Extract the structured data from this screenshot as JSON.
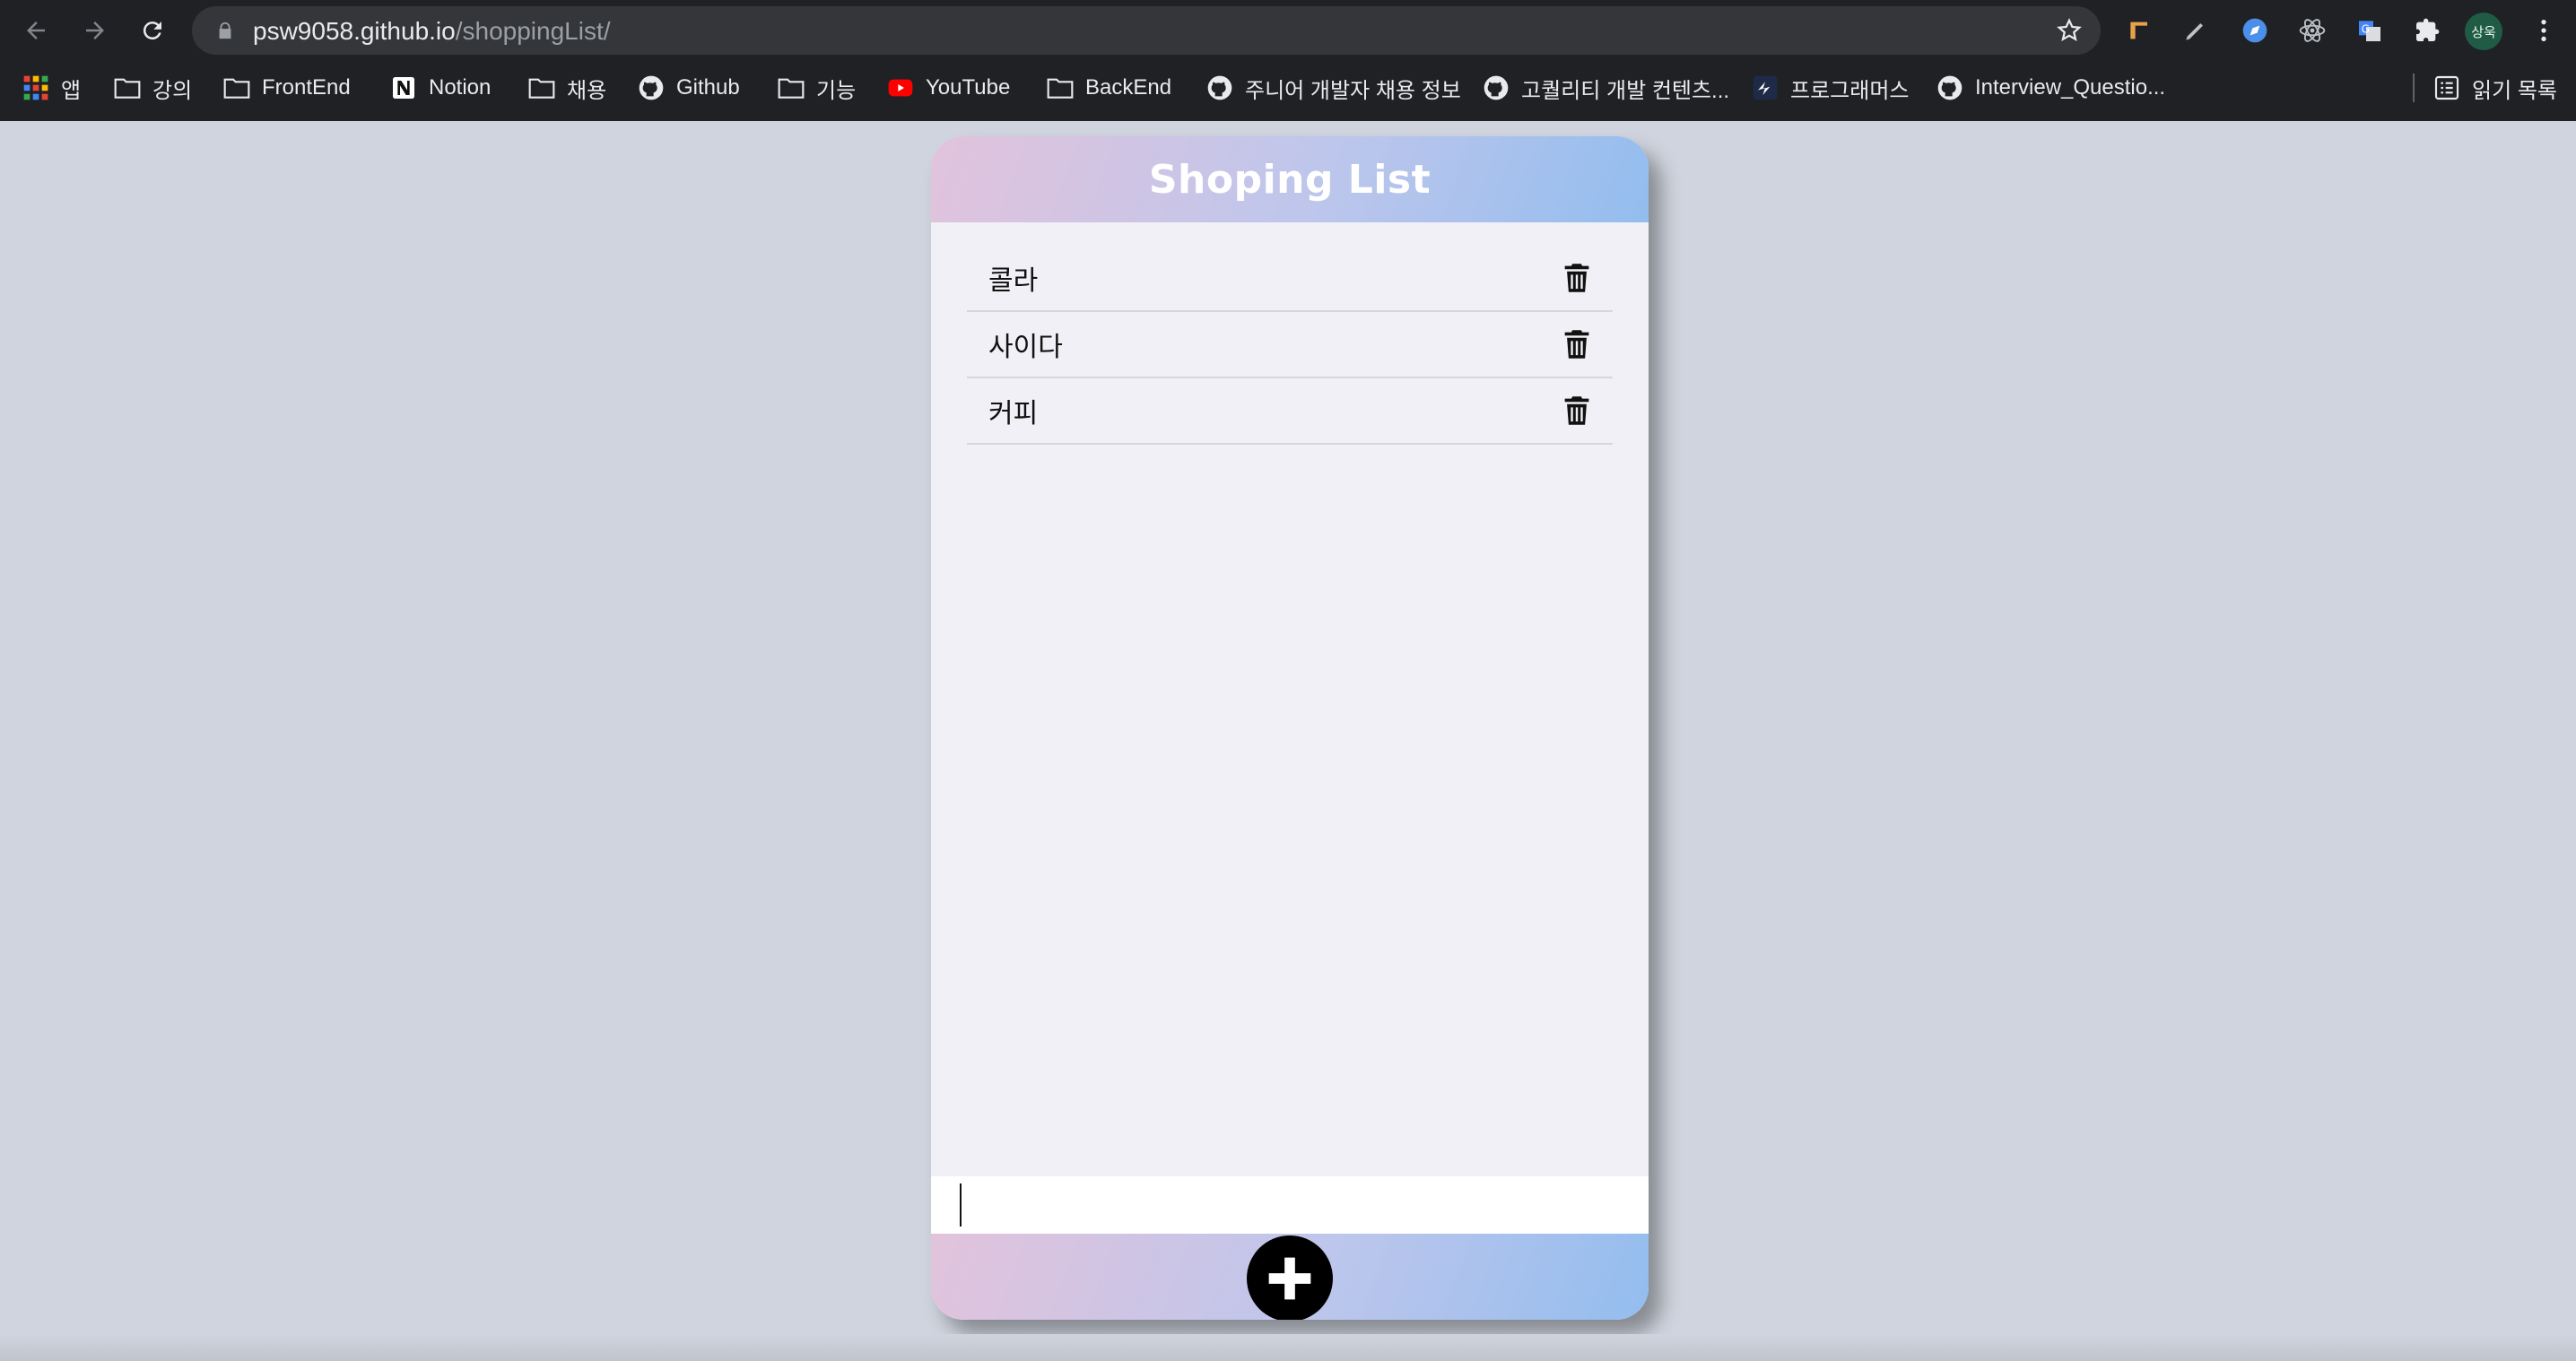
{
  "browser": {
    "url_host": "psw9058.github.io",
    "url_path": "/shoppingList/",
    "profile_initials": "상욱",
    "bookmarks": [
      {
        "label": "앱",
        "icon": "apps-grid-icon"
      },
      {
        "label": "강의",
        "icon": "folder-icon"
      },
      {
        "label": "FrontEnd",
        "icon": "folder-icon"
      },
      {
        "label": "Notion",
        "icon": "notion-icon"
      },
      {
        "label": "채용",
        "icon": "folder-icon"
      },
      {
        "label": "Github",
        "icon": "github-icon"
      },
      {
        "label": "기능",
        "icon": "folder-icon"
      },
      {
        "label": "YouTube",
        "icon": "youtube-icon"
      },
      {
        "label": "BackEnd",
        "icon": "folder-icon"
      },
      {
        "label": "주니어 개발자 채용 정보",
        "icon": "github-icon"
      },
      {
        "label": "고퀄리티 개발 컨텐츠...",
        "icon": "github-icon"
      },
      {
        "label": "프로그래머스",
        "icon": "programmers-icon"
      },
      {
        "label": "Interview_Questio...",
        "icon": "github-icon"
      }
    ],
    "reading_list_label": "읽기 목록"
  },
  "app": {
    "title": "Shoping List",
    "items": [
      {
        "name": "콜라"
      },
      {
        "name": "사이다"
      },
      {
        "name": "커피"
      }
    ],
    "input_value": "",
    "add_icon": "plus-icon",
    "delete_icon": "trash-icon"
  },
  "colors": {
    "gradient_start": "#e2c3dc",
    "gradient_end": "#93bdee",
    "list_background": "#f0f0f6",
    "page_background": "#cfd4de"
  }
}
